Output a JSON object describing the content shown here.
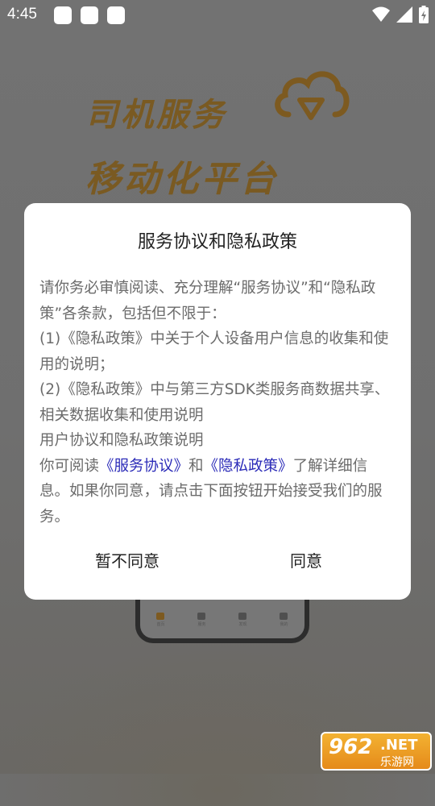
{
  "status_bar": {
    "time": "4:45",
    "notification_icons": [
      "app-notification-icon",
      "app-notification-icon",
      "app-notification-icon"
    ],
    "right_icons": [
      "wifi-icon",
      "signal-icon",
      "battery-charging-icon"
    ]
  },
  "splash": {
    "brand_line1": "司机服务",
    "brand_line2": "移动化平台",
    "logo": "cloud-download-logo",
    "phone_tabs": [
      "首页",
      "服务",
      "发现",
      "我的"
    ],
    "accent_color": "#e0a03a"
  },
  "dialog": {
    "title": "服务协议和隐私政策",
    "p1": "请你务必审慎阅读、充分理解“服务协议”和“隐私政策”各条款，包括但不限于：",
    "p2": "(1)《隐私政策》中关于个人设备用户信息的收集和使用的说明；",
    "p3": "(2)《隐私政策》中与第三方SDK类服务商数据共享、相关数据收集和使用说明",
    "p4": "用户协议和隐私政策说明",
    "p5_prefix": "你可阅读",
    "link_service": "《服务协议》",
    "p5_and": "和",
    "link_privacy": "《隐私政策》",
    "p5_suffix": "了解详细信息。如果你同意，请点击下面按钮开始接受我们的服务。",
    "btn_reject": "暂不同意",
    "btn_agree": "同意",
    "link_color": "#2b2bb8"
  },
  "watermark": {
    "number": "962",
    "domain": ".NET",
    "site_cn": "乐游网"
  }
}
